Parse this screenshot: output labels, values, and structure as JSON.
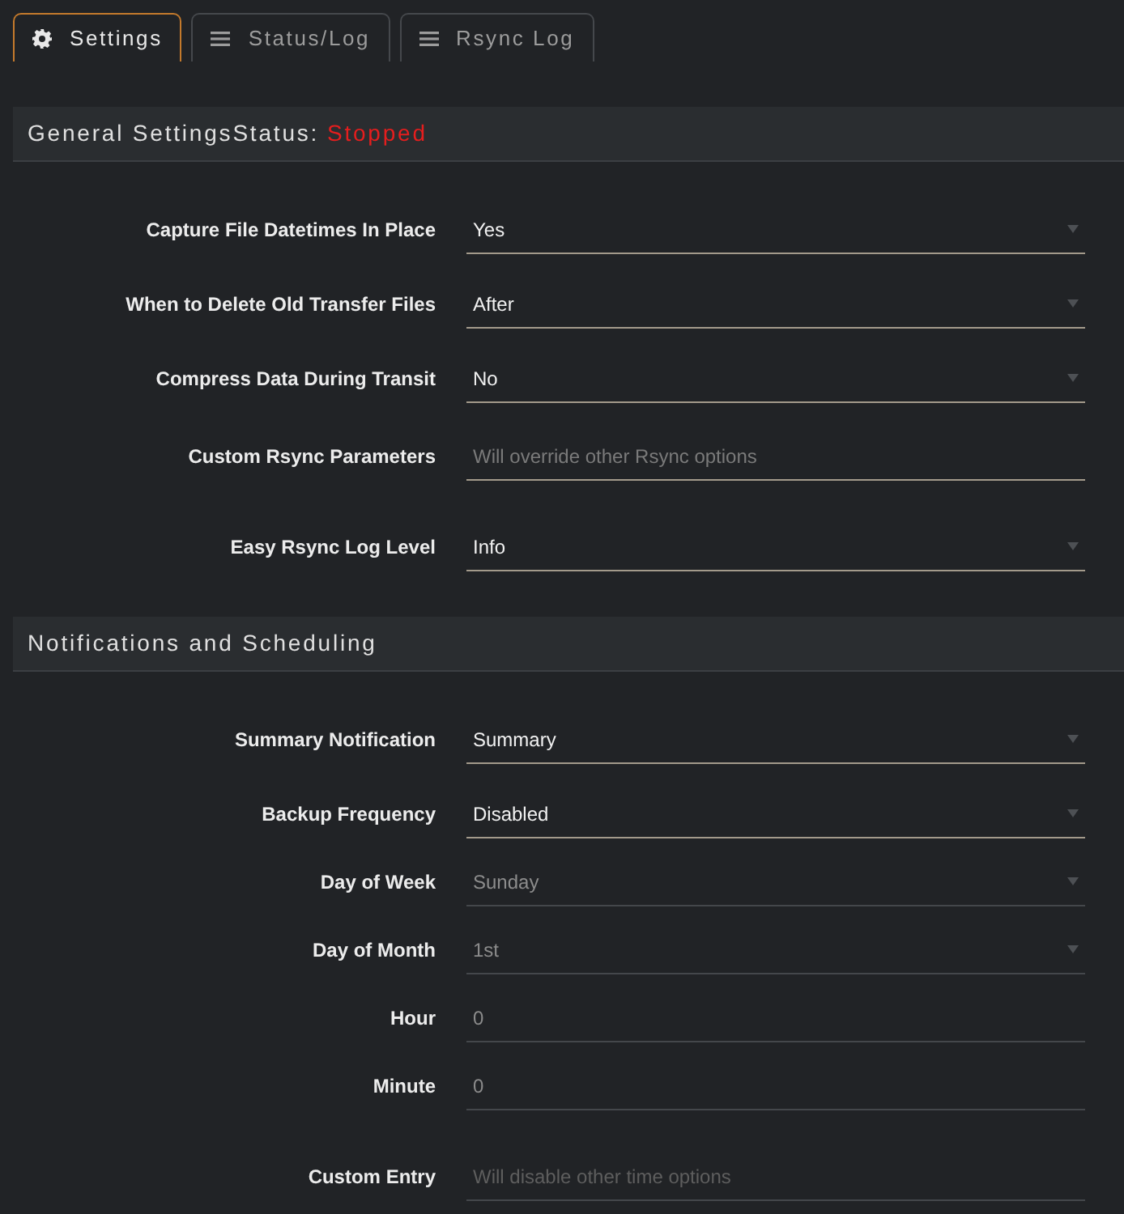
{
  "tabs": [
    {
      "label": "Settings",
      "kind": "settings",
      "selected": true
    },
    {
      "label": "Status/Log",
      "kind": "log",
      "selected": false
    },
    {
      "label": "Rsync Log",
      "kind": "log",
      "selected": false
    }
  ],
  "sections": [
    {
      "title": "General Settings",
      "status": {
        "label": "Status:",
        "value": "Stopped",
        "running": false
      },
      "fields": [
        {
          "label": "Capture File Datetimes In Place",
          "kind": "select",
          "value": "Yes",
          "disabled": false
        },
        {
          "label": "When to Delete Old Transfer Files",
          "kind": "select",
          "value": "After",
          "disabled": false
        },
        {
          "label": "Compress Data During Transit",
          "kind": "select",
          "value": "No",
          "disabled": false
        },
        {
          "label": "Custom Rsync Parameters",
          "kind": "text",
          "placeholder": "Will override other Rsync options",
          "disabled": false
        },
        {
          "label": "Easy Rsync Log Level",
          "kind": "select",
          "value": "Info",
          "disabled": false
        }
      ]
    },
    {
      "title": "Notifications and Scheduling",
      "fields": [
        {
          "label": "Summary Notification",
          "kind": "select",
          "value": "Summary",
          "disabled": false
        },
        {
          "label": "Backup Frequency",
          "kind": "select",
          "value": "Disabled",
          "disabled": false
        },
        {
          "label": "Day of Week",
          "kind": "select",
          "value": "Sunday",
          "disabled": true
        },
        {
          "label": "Day of Month",
          "kind": "select",
          "value": "1st",
          "disabled": true
        },
        {
          "label": "Hour",
          "kind": "text",
          "value": "0",
          "disabled": true
        },
        {
          "label": "Minute",
          "kind": "text",
          "value": "0",
          "disabled": true
        },
        {
          "label": "Custom Entry",
          "kind": "text",
          "placeholder": "Will disable other time options",
          "disabled": true
        }
      ]
    }
  ]
}
